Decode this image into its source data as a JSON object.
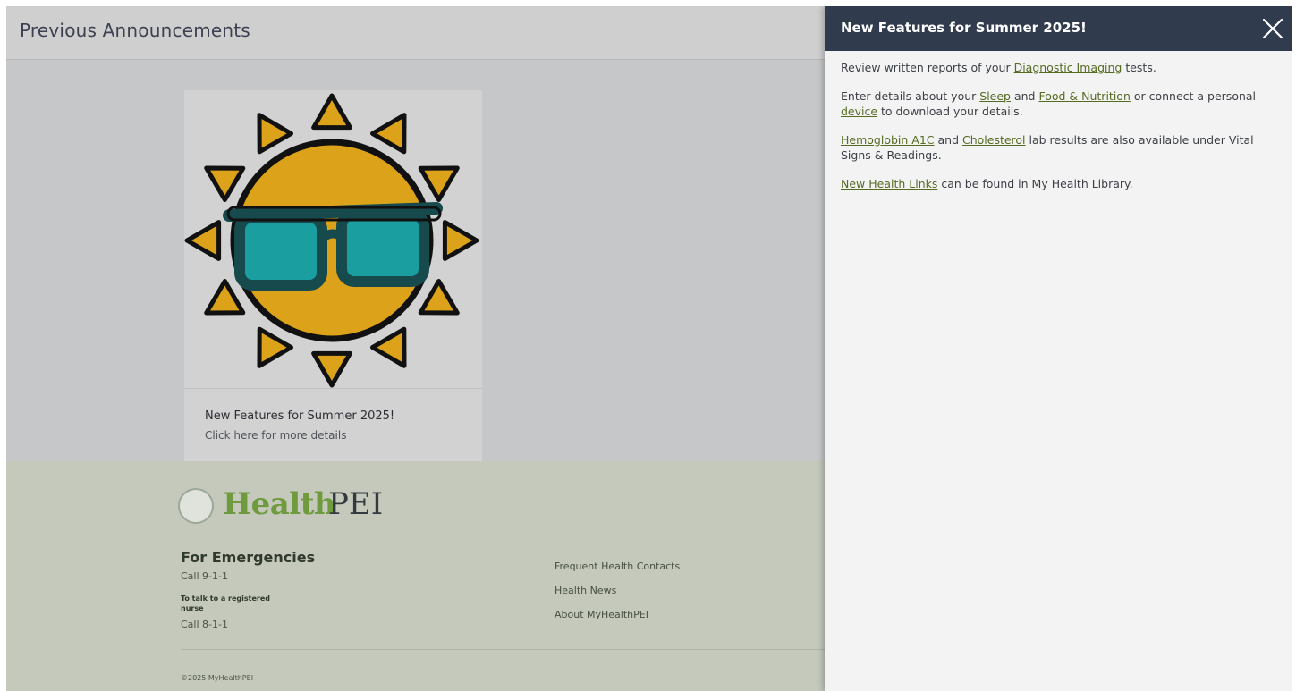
{
  "page": {
    "title": "Previous Announcements"
  },
  "card": {
    "title": "New Features for Summer 2025!",
    "subtitle": "Click here for more details",
    "image_icon": "sun-with-sunglasses-icon"
  },
  "footer": {
    "logo": {
      "word1": "Health",
      "word2": "PEI"
    },
    "emergency_heading": "For Emergencies",
    "emergency_call": "Call 9-1-1",
    "nurse_label": "To talk to a registered nurse",
    "nurse_call": "Call 8-1-1",
    "links": [
      "Frequent Health Contacts",
      "Health News",
      "About MyHealthPEI"
    ],
    "copyright": "©2025 MyHealthPEI"
  },
  "drawer": {
    "title": "New Features for Summer 2025!",
    "close_icon": "close-icon",
    "paragraphs": [
      {
        "t1": "Review written reports of your ",
        "l1": "Diagnostic Imaging",
        "t2": " tests."
      },
      {
        "t1": "Enter details about your ",
        "l1": "Sleep",
        "t2": " and ",
        "l2": "Food & Nutrition",
        "t3": " or connect a personal ",
        "l3": "device",
        "t4": " to download your details."
      },
      {
        "l1": "Hemoglobin A1C",
        "t1": " and ",
        "l2": "Cholesterol",
        "t2": " lab results are also available under Vital Signs & Readings."
      },
      {
        "l1": "New Health Links",
        "t1": " can be found in My Health Library."
      }
    ]
  },
  "colors": {
    "drawer_header": "#313b4e",
    "link": "#556b22",
    "sun": "#dba21a",
    "lens": "#1a9ea0"
  }
}
